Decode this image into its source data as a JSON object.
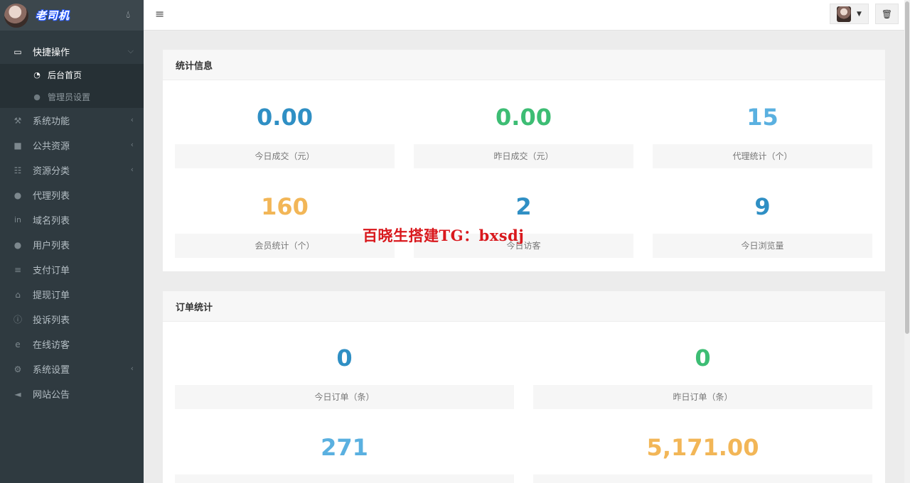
{
  "sidebar": {
    "brand": "老司机",
    "menu": [
      {
        "label": "快捷操作",
        "icon": "folder-open-icon",
        "open": true,
        "children": [
          {
            "label": "后台首页",
            "icon": "dashboard-icon",
            "active": true
          },
          {
            "label": "管理员设置",
            "icon": "user-icon",
            "active": false
          }
        ]
      },
      {
        "label": "系统功能",
        "icon": "wrench-icon",
        "arrow": true
      },
      {
        "label": "公共资源",
        "icon": "video-camera-icon",
        "arrow": true
      },
      {
        "label": "资源分类",
        "icon": "grid-icon",
        "arrow": true
      },
      {
        "label": "代理列表",
        "icon": "users-icon"
      },
      {
        "label": "域名列表",
        "icon": "linkedin-icon"
      },
      {
        "label": "用户列表",
        "icon": "user-icon"
      },
      {
        "label": "支付订单",
        "icon": "database-icon"
      },
      {
        "label": "提现订单",
        "icon": "bank-icon"
      },
      {
        "label": "投诉列表",
        "icon": "exclamation-circle-icon"
      },
      {
        "label": "在线访客",
        "icon": "internet-explorer-icon"
      },
      {
        "label": "系统设置",
        "icon": "gear-icon",
        "arrow": true
      },
      {
        "label": "网站公告",
        "icon": "bullhorn-icon"
      }
    ]
  },
  "panels": {
    "stats": {
      "title": "统计信息",
      "items": [
        {
          "value": "0.00",
          "label": "今日成交（元）",
          "color": "#2f8fc4"
        },
        {
          "value": "0.00",
          "label": "昨日成交（元）",
          "color": "#3dbd74"
        },
        {
          "value": "15",
          "label": "代理统计（个）",
          "color": "#5ab0e0"
        },
        {
          "value": "160",
          "label": "会员统计（个）",
          "color": "#f2b657"
        },
        {
          "value": "2",
          "label": "今日访客",
          "color": "#2f8fc4"
        },
        {
          "value": "9",
          "label": "今日浏览量",
          "color": "#2f8fc4"
        }
      ]
    },
    "orders": {
      "title": "订单统计",
      "items": [
        {
          "value": "0",
          "label": "今日订单（条）",
          "color": "#2f8fc4"
        },
        {
          "value": "0",
          "label": "昨日订单（条）",
          "color": "#3dbd74"
        },
        {
          "value": "271",
          "label": "",
          "color": "#5ab0e0"
        },
        {
          "value": "5,171.00",
          "label": "",
          "color": "#f2b657"
        }
      ]
    }
  },
  "watermark": "百晓生搭建TG：bxsdj"
}
